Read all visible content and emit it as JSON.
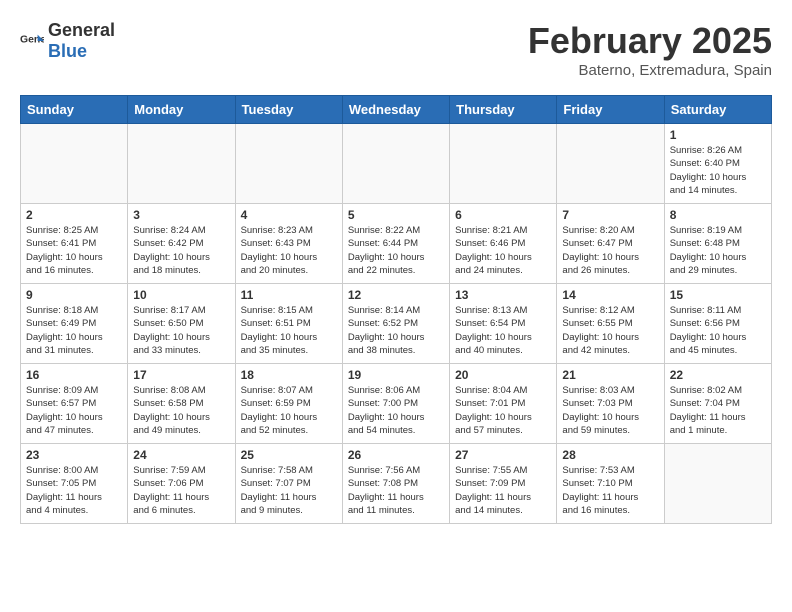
{
  "header": {
    "logo_general": "General",
    "logo_blue": "Blue",
    "month_title": "February 2025",
    "subtitle": "Baterno, Extremadura, Spain"
  },
  "weekdays": [
    "Sunday",
    "Monday",
    "Tuesday",
    "Wednesday",
    "Thursday",
    "Friday",
    "Saturday"
  ],
  "weeks": [
    [
      {
        "day": "",
        "info": ""
      },
      {
        "day": "",
        "info": ""
      },
      {
        "day": "",
        "info": ""
      },
      {
        "day": "",
        "info": ""
      },
      {
        "day": "",
        "info": ""
      },
      {
        "day": "",
        "info": ""
      },
      {
        "day": "1",
        "info": "Sunrise: 8:26 AM\nSunset: 6:40 PM\nDaylight: 10 hours\nand 14 minutes."
      }
    ],
    [
      {
        "day": "2",
        "info": "Sunrise: 8:25 AM\nSunset: 6:41 PM\nDaylight: 10 hours\nand 16 minutes."
      },
      {
        "day": "3",
        "info": "Sunrise: 8:24 AM\nSunset: 6:42 PM\nDaylight: 10 hours\nand 18 minutes."
      },
      {
        "day": "4",
        "info": "Sunrise: 8:23 AM\nSunset: 6:43 PM\nDaylight: 10 hours\nand 20 minutes."
      },
      {
        "day": "5",
        "info": "Sunrise: 8:22 AM\nSunset: 6:44 PM\nDaylight: 10 hours\nand 22 minutes."
      },
      {
        "day": "6",
        "info": "Sunrise: 8:21 AM\nSunset: 6:46 PM\nDaylight: 10 hours\nand 24 minutes."
      },
      {
        "day": "7",
        "info": "Sunrise: 8:20 AM\nSunset: 6:47 PM\nDaylight: 10 hours\nand 26 minutes."
      },
      {
        "day": "8",
        "info": "Sunrise: 8:19 AM\nSunset: 6:48 PM\nDaylight: 10 hours\nand 29 minutes."
      }
    ],
    [
      {
        "day": "9",
        "info": "Sunrise: 8:18 AM\nSunset: 6:49 PM\nDaylight: 10 hours\nand 31 minutes."
      },
      {
        "day": "10",
        "info": "Sunrise: 8:17 AM\nSunset: 6:50 PM\nDaylight: 10 hours\nand 33 minutes."
      },
      {
        "day": "11",
        "info": "Sunrise: 8:15 AM\nSunset: 6:51 PM\nDaylight: 10 hours\nand 35 minutes."
      },
      {
        "day": "12",
        "info": "Sunrise: 8:14 AM\nSunset: 6:52 PM\nDaylight: 10 hours\nand 38 minutes."
      },
      {
        "day": "13",
        "info": "Sunrise: 8:13 AM\nSunset: 6:54 PM\nDaylight: 10 hours\nand 40 minutes."
      },
      {
        "day": "14",
        "info": "Sunrise: 8:12 AM\nSunset: 6:55 PM\nDaylight: 10 hours\nand 42 minutes."
      },
      {
        "day": "15",
        "info": "Sunrise: 8:11 AM\nSunset: 6:56 PM\nDaylight: 10 hours\nand 45 minutes."
      }
    ],
    [
      {
        "day": "16",
        "info": "Sunrise: 8:09 AM\nSunset: 6:57 PM\nDaylight: 10 hours\nand 47 minutes."
      },
      {
        "day": "17",
        "info": "Sunrise: 8:08 AM\nSunset: 6:58 PM\nDaylight: 10 hours\nand 49 minutes."
      },
      {
        "day": "18",
        "info": "Sunrise: 8:07 AM\nSunset: 6:59 PM\nDaylight: 10 hours\nand 52 minutes."
      },
      {
        "day": "19",
        "info": "Sunrise: 8:06 AM\nSunset: 7:00 PM\nDaylight: 10 hours\nand 54 minutes."
      },
      {
        "day": "20",
        "info": "Sunrise: 8:04 AM\nSunset: 7:01 PM\nDaylight: 10 hours\nand 57 minutes."
      },
      {
        "day": "21",
        "info": "Sunrise: 8:03 AM\nSunset: 7:03 PM\nDaylight: 10 hours\nand 59 minutes."
      },
      {
        "day": "22",
        "info": "Sunrise: 8:02 AM\nSunset: 7:04 PM\nDaylight: 11 hours\nand 1 minute."
      }
    ],
    [
      {
        "day": "23",
        "info": "Sunrise: 8:00 AM\nSunset: 7:05 PM\nDaylight: 11 hours\nand 4 minutes."
      },
      {
        "day": "24",
        "info": "Sunrise: 7:59 AM\nSunset: 7:06 PM\nDaylight: 11 hours\nand 6 minutes."
      },
      {
        "day": "25",
        "info": "Sunrise: 7:58 AM\nSunset: 7:07 PM\nDaylight: 11 hours\nand 9 minutes."
      },
      {
        "day": "26",
        "info": "Sunrise: 7:56 AM\nSunset: 7:08 PM\nDaylight: 11 hours\nand 11 minutes."
      },
      {
        "day": "27",
        "info": "Sunrise: 7:55 AM\nSunset: 7:09 PM\nDaylight: 11 hours\nand 14 minutes."
      },
      {
        "day": "28",
        "info": "Sunrise: 7:53 AM\nSunset: 7:10 PM\nDaylight: 11 hours\nand 16 minutes."
      },
      {
        "day": "",
        "info": ""
      }
    ]
  ]
}
